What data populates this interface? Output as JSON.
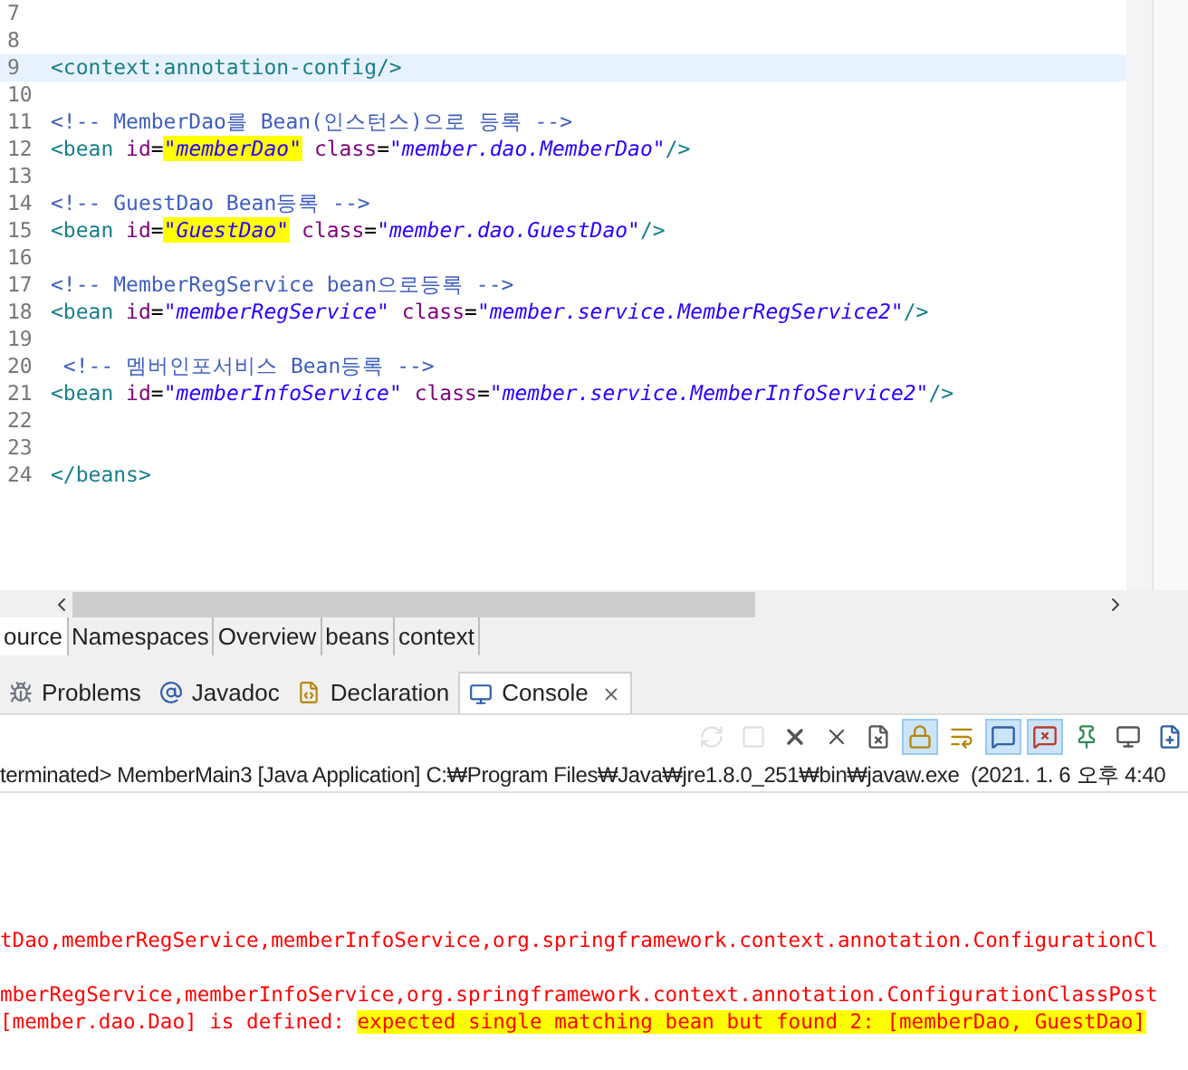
{
  "editor": {
    "lines": [
      {
        "number": "7",
        "current": false
      },
      {
        "number": "8",
        "current": false
      },
      {
        "number": "9",
        "current": true,
        "segments": [
          {
            "kind": "tag",
            "text": "<context:annotation-config/>"
          }
        ]
      },
      {
        "number": "10",
        "current": false
      },
      {
        "number": "11",
        "current": false,
        "segments": [
          {
            "kind": "comment",
            "text": "<!-- MemberDao를 Bean(인스턴스)으로 등록 -->"
          }
        ]
      },
      {
        "number": "12",
        "current": false,
        "segments": [
          {
            "kind": "tag",
            "text": "<bean "
          },
          {
            "kind": "attr",
            "text": "id"
          },
          {
            "kind": "plain",
            "text": "="
          },
          {
            "kind": "value",
            "text": "\"memberDao\"",
            "highlight": true
          },
          {
            "kind": "attr",
            "text": " class"
          },
          {
            "kind": "plain",
            "text": "="
          },
          {
            "kind": "value",
            "text": "\"member.dao.MemberDao\"",
            "highlight": false
          },
          {
            "kind": "tag",
            "text": "/>"
          }
        ]
      },
      {
        "number": "13",
        "current": false
      },
      {
        "number": "14",
        "current": false,
        "segments": [
          {
            "kind": "comment",
            "text": "<!-- GuestDao Bean등록 -->"
          }
        ]
      },
      {
        "number": "15",
        "current": false,
        "segments": [
          {
            "kind": "tag",
            "text": "<bean "
          },
          {
            "kind": "attr",
            "text": "id"
          },
          {
            "kind": "plain",
            "text": "="
          },
          {
            "kind": "value",
            "text": "\"GuestDao\"",
            "highlight": true
          },
          {
            "kind": "attr",
            "text": " class"
          },
          {
            "kind": "plain",
            "text": "="
          },
          {
            "kind": "value",
            "text": "\"member.dao.GuestDao\"",
            "highlight": false
          },
          {
            "kind": "tag",
            "text": "/>"
          }
        ]
      },
      {
        "number": "16",
        "current": false
      },
      {
        "number": "17",
        "current": false,
        "segments": [
          {
            "kind": "comment",
            "text": "<!-- MemberRegService bean으로등록 -->"
          }
        ]
      },
      {
        "number": "18",
        "current": false,
        "segments": [
          {
            "kind": "tag",
            "text": "<bean "
          },
          {
            "kind": "attr",
            "text": "id"
          },
          {
            "kind": "plain",
            "text": "="
          },
          {
            "kind": "value",
            "text": "\"memberRegService\"",
            "highlight": false
          },
          {
            "kind": "attr",
            "text": " class"
          },
          {
            "kind": "plain",
            "text": "="
          },
          {
            "kind": "value",
            "text": "\"member.service.MemberRegService2\"",
            "highlight": false
          },
          {
            "kind": "tag",
            "text": "/>"
          }
        ]
      },
      {
        "number": "19",
        "current": false
      },
      {
        "number": "20",
        "current": false,
        "segments": [
          {
            "kind": "comment",
            "text": " <!-- 멤버인포서비스 Bean등록 -->"
          }
        ]
      },
      {
        "number": "21",
        "current": false,
        "segments": [
          {
            "kind": "tag",
            "text": "<bean "
          },
          {
            "kind": "attr",
            "text": "id"
          },
          {
            "kind": "plain",
            "text": "="
          },
          {
            "kind": "value",
            "text": "\"memberInfoService\"",
            "highlight": false
          },
          {
            "kind": "attr",
            "text": " class"
          },
          {
            "kind": "plain",
            "text": "="
          },
          {
            "kind": "value",
            "text": "\"member.service.MemberInfoService2\"",
            "highlight": false
          },
          {
            "kind": "tag",
            "text": "/>"
          }
        ]
      },
      {
        "number": "22",
        "current": false
      },
      {
        "number": "23",
        "current": false
      },
      {
        "number": "24",
        "current": false,
        "segments": [
          {
            "kind": "tag",
            "text": "</beans>"
          }
        ]
      }
    ]
  },
  "editor_tabs": [
    {
      "label": "ource",
      "selected": true
    },
    {
      "label": "Namespaces",
      "selected": false
    },
    {
      "label": "Overview",
      "selected": false
    },
    {
      "label": "beans",
      "selected": false
    },
    {
      "label": "context",
      "selected": false
    }
  ],
  "view_tabs": [
    {
      "label": "Problems",
      "kind": "problems",
      "selected": false
    },
    {
      "label": "Javadoc",
      "kind": "javadoc",
      "selected": false
    },
    {
      "label": "Declaration",
      "kind": "declaration",
      "selected": false
    },
    {
      "label": "Console",
      "kind": "console",
      "selected": true
    }
  ],
  "console_toolbar": [
    {
      "kind": "sync",
      "selected": false,
      "disabled": true
    },
    {
      "kind": "stop",
      "selected": false,
      "disabled": true
    },
    {
      "kind": "remove",
      "selected": false,
      "disabled": false
    },
    {
      "kind": "remove-all",
      "selected": false,
      "disabled": false
    },
    {
      "kind": "clear",
      "selected": false,
      "disabled": false
    },
    {
      "kind": "lock",
      "selected": true,
      "disabled": false
    },
    {
      "kind": "wrap",
      "selected": false,
      "disabled": false
    },
    {
      "kind": "show-out",
      "selected": true,
      "disabled": false
    },
    {
      "kind": "show-err",
      "selected": true,
      "disabled": false
    },
    {
      "kind": "pin",
      "selected": false,
      "disabled": false
    },
    {
      "kind": "display",
      "selected": false,
      "disabled": false
    },
    {
      "kind": "new",
      "selected": false,
      "disabled": false
    }
  ],
  "console": {
    "status": "terminated> MemberMain3 [Java Application] C:₩Program Files₩Java₩jre1.8.0_251₩bin₩javaw.exe  (2021. 1. 6 오후 4:40",
    "lines": [
      {
        "segments": [
          {
            "text": "tDao,memberRegService,memberInfoService,org.springframework.context.annotation.ConfigurationCl",
            "highlight": false
          }
        ]
      },
      {
        "segments": [
          {
            "text": "mberRegService,memberInfoService,org.springframework.context.annotation.ConfigurationClassPost",
            "highlight": false
          }
        ]
      },
      {
        "segments": [
          {
            "text": "[member.dao.Dao] is defined: ",
            "highlight": false
          },
          {
            "text": "expected single matching bean but found 2: [memberDao, GuestDao]",
            "highlight": true
          }
        ]
      }
    ]
  }
}
